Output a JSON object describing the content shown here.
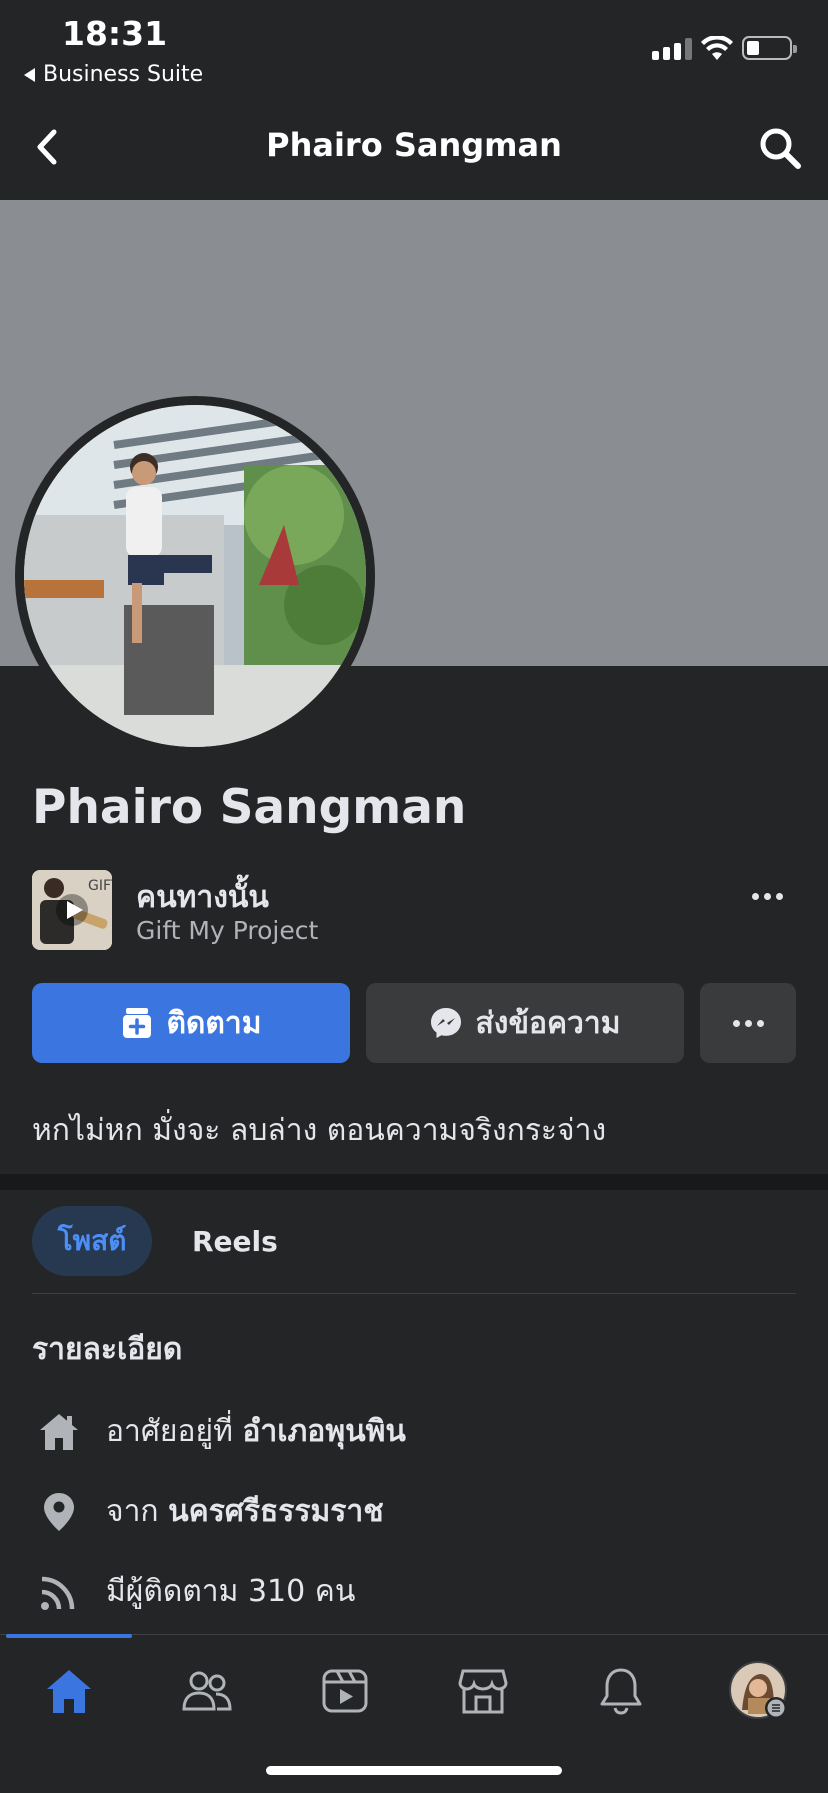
{
  "status_bar": {
    "time": "18:31",
    "back_app": "Business Suite"
  },
  "nav": {
    "title": "Phairo Sangman"
  },
  "profile": {
    "name": "Phairo Sangman"
  },
  "featured": {
    "title": "คนทางนั้น",
    "subtitle": "Gift My Project"
  },
  "actions": {
    "follow": "ติดตาม",
    "message": "ส่งข้อความ"
  },
  "bio": "หกไม่หก มั่งจะ ลบล่าง ตอนความจริงกระจ่าง",
  "tabs": [
    {
      "label": "โพสต์",
      "active": true
    },
    {
      "label": "Reels",
      "active": false
    }
  ],
  "details": {
    "heading": "รายละเอียด",
    "lives_prefix": "อาศัยอยู่ที่",
    "lives_place": "อำเภอพุนพิน",
    "from_prefix": "จาก",
    "from_place": "นครศรีธรรมราช",
    "followers": "มีผู้ติดตาม 310 คน"
  },
  "bottom_nav": [
    "home-icon",
    "friends-icon",
    "watch-icon",
    "marketplace-icon",
    "notifications-icon",
    "profile-menu-icon"
  ],
  "colors": {
    "accent": "#3a75e0",
    "background": "#242526",
    "cover": "#8a8d91"
  }
}
